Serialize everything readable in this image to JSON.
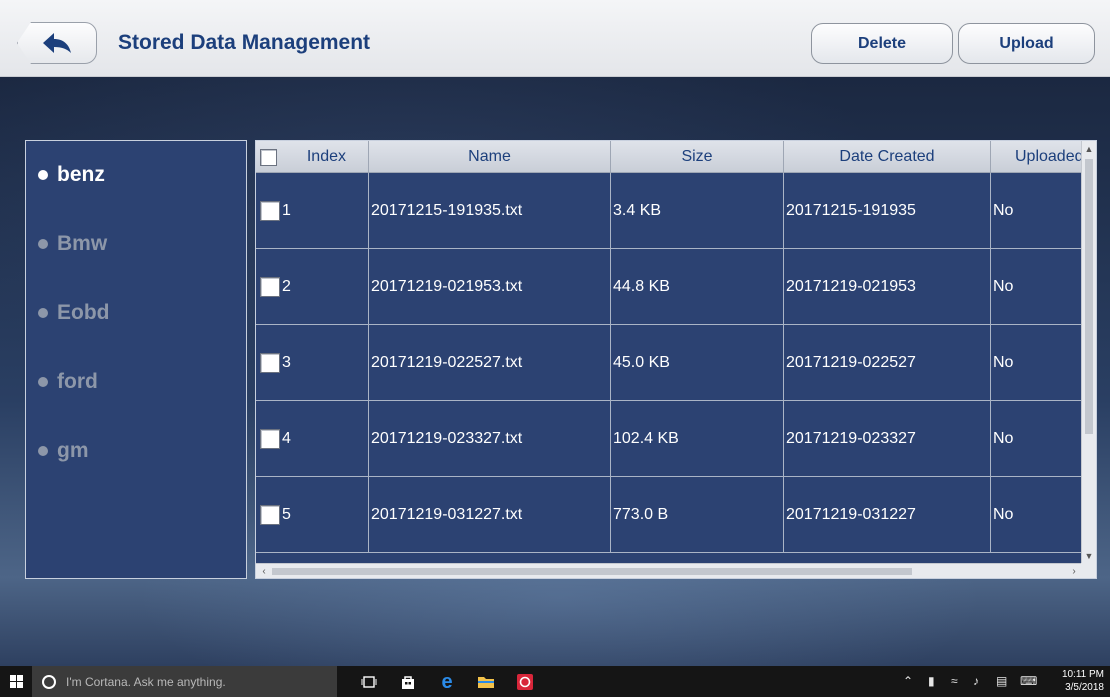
{
  "header": {
    "title": "Stored Data Management",
    "delete_label": "Delete",
    "upload_label": "Upload"
  },
  "sidebar": {
    "items": [
      {
        "label": "benz",
        "active": true
      },
      {
        "label": "Bmw",
        "active": false
      },
      {
        "label": "Eobd",
        "active": false
      },
      {
        "label": "ford",
        "active": false
      },
      {
        "label": "gm",
        "active": false
      }
    ]
  },
  "table": {
    "columns": [
      "Index",
      "Name",
      "Size",
      "Date Created",
      "Uploaded"
    ],
    "rows": [
      {
        "index": "1",
        "name": "20171215-191935.txt",
        "size": "3.4 KB",
        "date": "20171215-191935",
        "uploaded": "No"
      },
      {
        "index": "2",
        "name": "20171219-021953.txt",
        "size": "44.8 KB",
        "date": "20171219-021953",
        "uploaded": "No"
      },
      {
        "index": "3",
        "name": "20171219-022527.txt",
        "size": "45.0 KB",
        "date": "20171219-022527",
        "uploaded": "No"
      },
      {
        "index": "4",
        "name": "20171219-023327.txt",
        "size": "102.4 KB",
        "date": "20171219-023327",
        "uploaded": "No"
      },
      {
        "index": "5",
        "name": "20171219-031227.txt",
        "size": "773.0 B",
        "date": "20171219-031227",
        "uploaded": "No"
      }
    ]
  },
  "taskbar": {
    "search_placeholder": "I'm Cortana. Ask me anything.",
    "time": "10:11 PM",
    "date": "3/5/2018"
  },
  "colors": {
    "title_blue": "#1c3f7c",
    "panel_bg": "#2c4272",
    "taskbar_bg": "#151515"
  }
}
